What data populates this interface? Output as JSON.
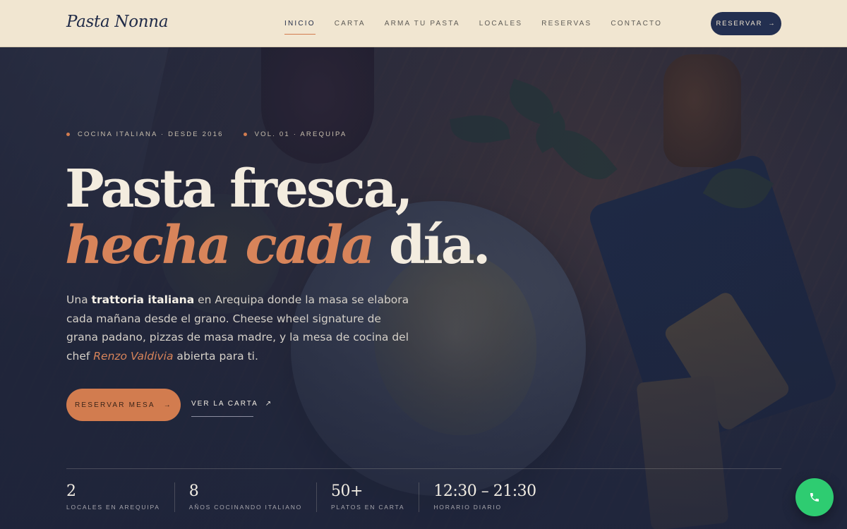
{
  "header": {
    "logo": "Pasta Nonna",
    "nav": [
      "INICIO",
      "CARTA",
      "ARMA TU PASTA",
      "LOCALES",
      "RESERVAS",
      "CONTACTO"
    ],
    "active_nav": "INICIO",
    "cta_label": "RESERVAR",
    "cta_arrow": "→"
  },
  "hero": {
    "eyebrow": [
      "COCINA ITALIANA · DESDE 2016",
      "VOL. 01 · AREQUIPA"
    ],
    "headline_line1": "Pasta fresca,",
    "headline_accent": "hecha cada",
    "headline_end": "día.",
    "intro": {
      "p1": "Una ",
      "bold": "trattoria italiana",
      "p2": " en Arequipa donde la masa se elabora cada mañana desde el grano. Cheese wheel signature de grana padano, pizzas de masa madre, y la mesa de cocina del chef ",
      "chef": "Renzo Valdivia",
      "p3": " abierta para ti."
    },
    "primary_cta": "RESERVAR MESA",
    "primary_cta_arrow": "→",
    "secondary_cta": "VER LA CARTA",
    "secondary_cta_arrow": "↗"
  },
  "stats": [
    {
      "value": "2",
      "label": "LOCALES EN AREQUIPA"
    },
    {
      "value": "8",
      "label": "AÑOS COCINANDO ITALIANO"
    },
    {
      "value": "50+",
      "label": "PLATOS EN CARTA"
    },
    {
      "value": "12:30 – 21:30",
      "label": "HORARIO DIARIO"
    }
  ],
  "call_button_icon": "phone-icon",
  "colors": {
    "header_bg": "#f1e6d1",
    "navy": "#232f50",
    "accent": "#d27c4f",
    "call_green": "#2ecc71"
  }
}
